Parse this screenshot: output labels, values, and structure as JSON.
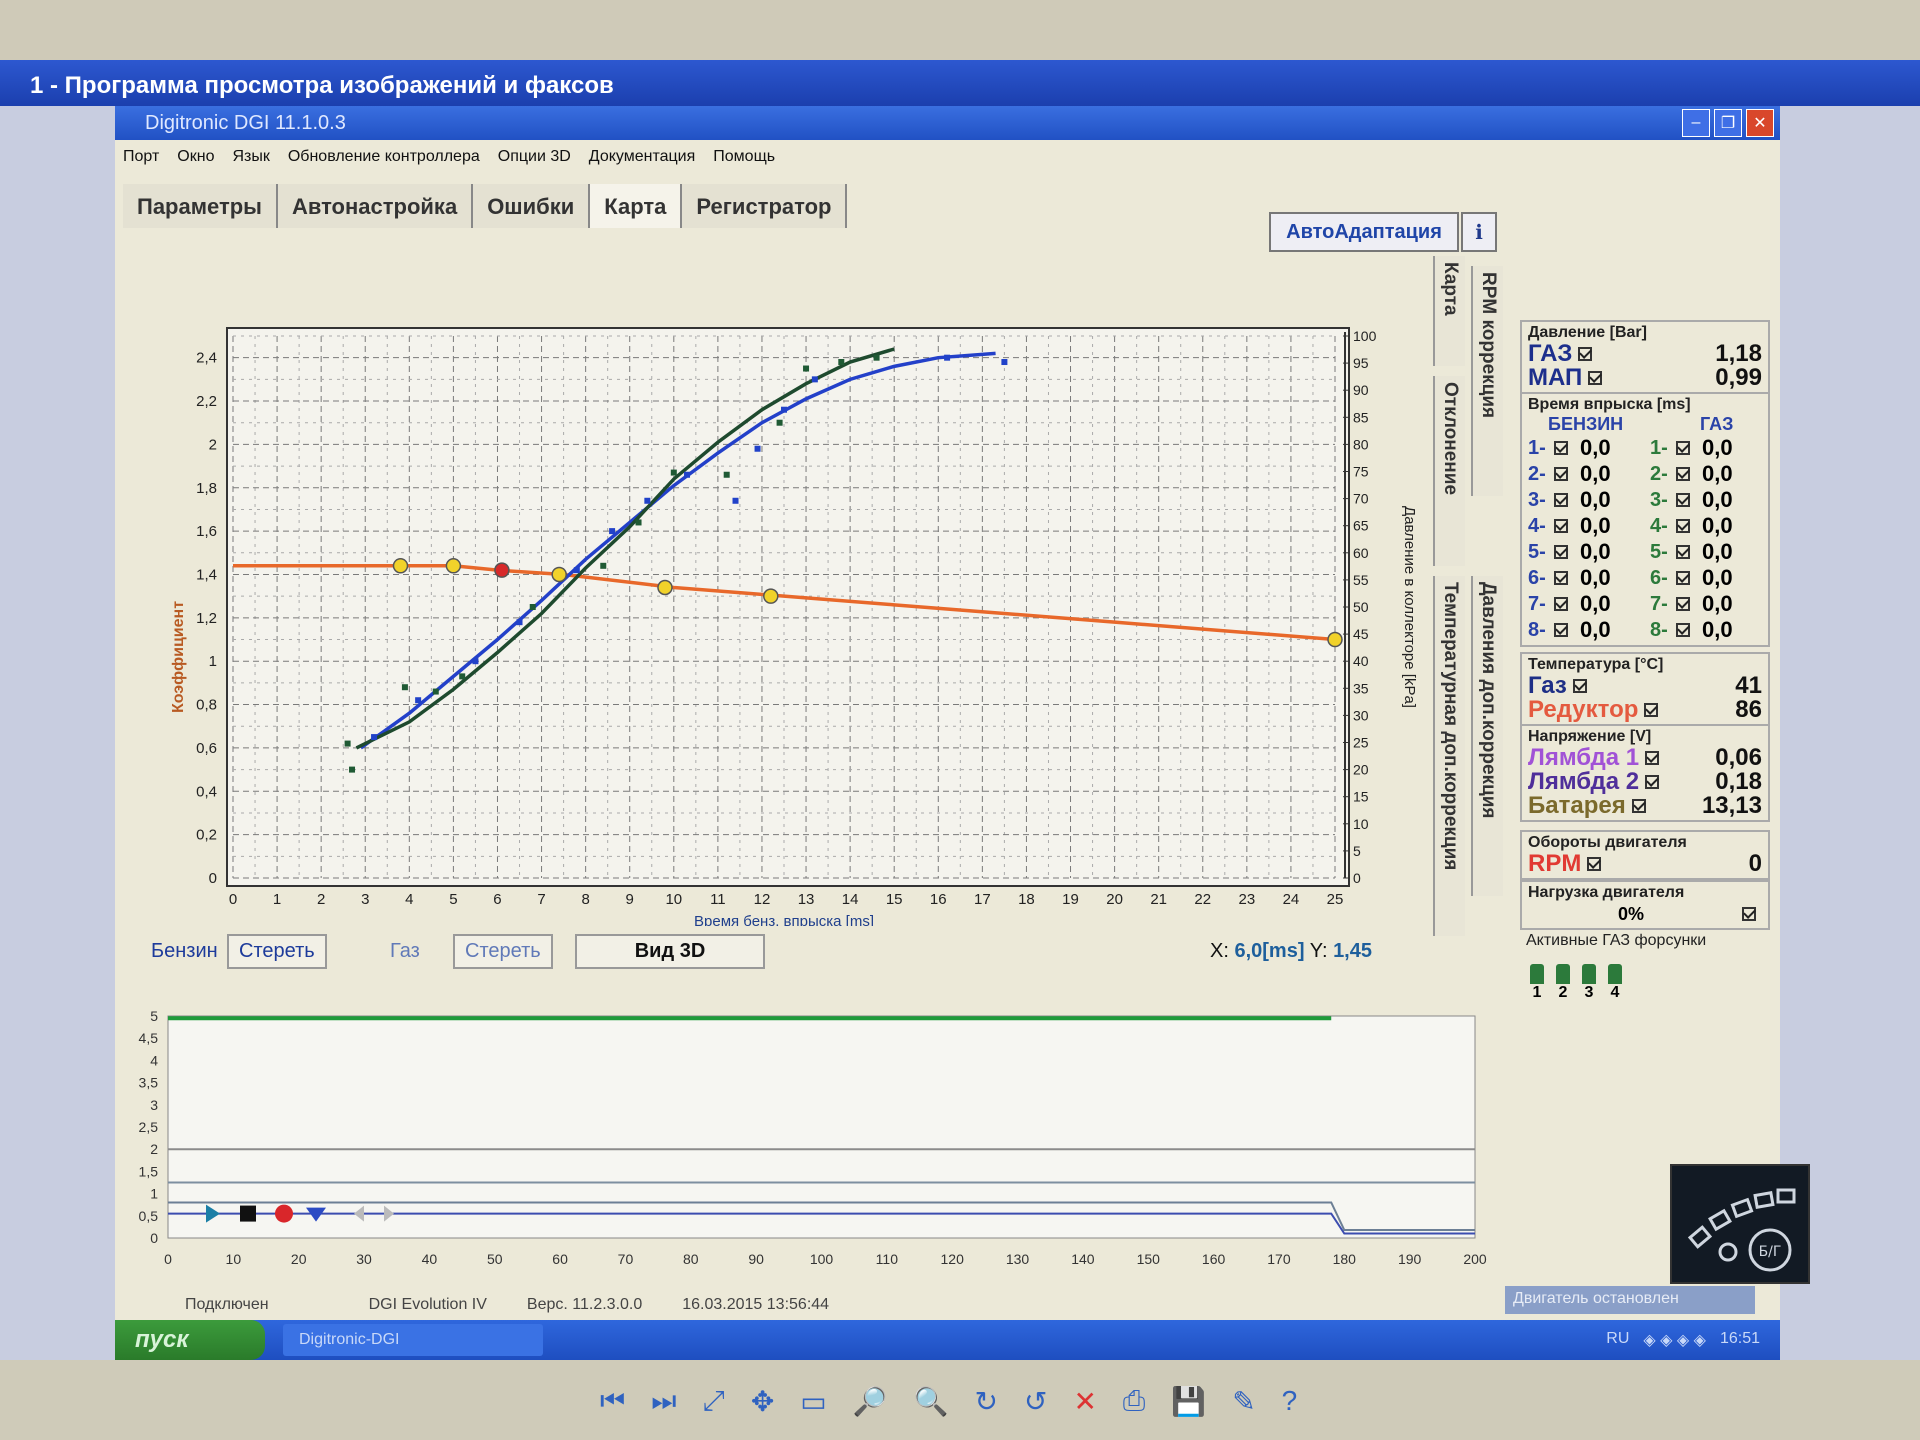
{
  "viewer": {
    "title": "1 - Программа просмотра изображений и факсов",
    "toolbar_icons": [
      "prev-icon",
      "next-icon",
      "fit-icon",
      "actual-size-icon",
      "slideshow-icon",
      "zoom-in-icon",
      "zoom-out-icon",
      "rotate-cw-icon",
      "rotate-ccw-icon",
      "delete-icon",
      "print-icon",
      "save-icon",
      "edit-icon",
      "help-icon"
    ]
  },
  "app": {
    "title": "Digitronic DGI 11.1.0.3",
    "menu": [
      "Порт",
      "Окно",
      "Язык",
      "Обновление контроллера",
      "Опции 3D",
      "Документация",
      "Помощь"
    ],
    "tabs": [
      "Параметры",
      "Автонастройка",
      "Ошибки",
      "Карта",
      "Регистратор"
    ],
    "active_tab": "Карта",
    "autoadapt_label": "АвтоАдаптация",
    "info_label": "ℹ",
    "vtabs": [
      "RPM коррекция",
      "Карта",
      "Отклонение",
      "Давления доп.коррекция",
      "Температурная доп.коррекция"
    ]
  },
  "controls": {
    "petrol_label": "Бензин",
    "erase1": "Стереть",
    "gas_label": "Газ",
    "erase2": "Стереть",
    "view3d": "Вид 3D",
    "coord_x_label": "X:",
    "coord_x": "6,0[ms]",
    "coord_y_label": "Y:",
    "coord_y": "1,45"
  },
  "panel": {
    "pressure_title": "Давление [Bar]",
    "gas_label": "ГАЗ",
    "gas_val": "1,18",
    "map_label": "МАП",
    "map_val": "0,99",
    "inj_title": "Время впрыска [ms]",
    "petrol_col": "БЕНЗИН",
    "gas_col": "ГАЗ",
    "petrol_inj": [
      [
        "1-",
        "0,0"
      ],
      [
        "2-",
        "0,0"
      ],
      [
        "3-",
        "0,0"
      ],
      [
        "4-",
        "0,0"
      ],
      [
        "5-",
        "0,0"
      ],
      [
        "6-",
        "0,0"
      ],
      [
        "7-",
        "0,0"
      ],
      [
        "8-",
        "0,0"
      ]
    ],
    "gas_inj": [
      [
        "1-",
        "0,0"
      ],
      [
        "2-",
        "0,0"
      ],
      [
        "3-",
        "0,0"
      ],
      [
        "4-",
        "0,0"
      ],
      [
        "5-",
        "0,0"
      ],
      [
        "6-",
        "0,0"
      ],
      [
        "7-",
        "0,0"
      ],
      [
        "8-",
        "0,0"
      ]
    ],
    "temp_title": "Температура [°C]",
    "temp_gas_label": "Газ",
    "temp_gas_val": "41",
    "temp_red_label": "Редуктор",
    "temp_red_val": "86",
    "volt_title": "Напряжение [V]",
    "lambda1_label": "Лямбда 1",
    "lambda1_val": "0,06",
    "lambda2_label": "Лямбда 2",
    "lambda2_val": "0,18",
    "battery_label": "Батарея",
    "battery_val": "13,13",
    "rpm_title": "Обороты двигателя",
    "rpm_label": "RPM",
    "rpm_val": "0",
    "load_title": "Нагрузка двигателя",
    "load_val": "0%",
    "active_inj_title": "Активные ГАЗ форсунки",
    "active_inj": [
      "1",
      "2",
      "3",
      "4"
    ],
    "logo_text": "Б/Г"
  },
  "status": {
    "connected": "Подключен",
    "device": "DGI Evolution IV",
    "version": "Верс. 11.2.3.0.0",
    "datetime": "16.03.2015 13:56:44",
    "engine": "Двигатель остановлен"
  },
  "taskbar": {
    "start": "пуск",
    "task": "Digitronic-DGI",
    "lang": "RU",
    "time": "16:51"
  },
  "chart_data": [
    {
      "type": "line",
      "xlabel": "Время бенз. впрыска [ms]",
      "ylabel": "Коэффициент",
      "y2label": "Давление в коллекторе [kPa]",
      "xlim": [
        0,
        25
      ],
      "ylim": [
        0,
        2.5
      ],
      "y2lim": [
        0,
        100
      ],
      "x_ticks": [
        0,
        1,
        2,
        3,
        4,
        5,
        6,
        7,
        8,
        9,
        10,
        11,
        12,
        13,
        14,
        15,
        16,
        17,
        18,
        19,
        20,
        21,
        22,
        23,
        24,
        25
      ],
      "y_ticks": [
        "0",
        "0,2",
        "0,4",
        "0,6",
        "0,8",
        "1",
        "1,2",
        "1,4",
        "1,6",
        "1,8",
        "2",
        "2,2",
        "2,4"
      ],
      "y2_ticks": [
        0,
        5,
        10,
        15,
        20,
        25,
        30,
        35,
        40,
        45,
        50,
        55,
        60,
        65,
        70,
        75,
        80,
        85,
        90,
        95,
        100
      ],
      "grid": true,
      "series": [
        {
          "color": "#e8682a",
          "x": [
            0,
            4,
            5,
            6,
            7.5,
            10,
            12.5,
            15,
            17.5,
            20,
            22.5,
            25
          ],
          "y": [
            1.44,
            1.44,
            1.44,
            1.42,
            1.4,
            1.34,
            1.3,
            1.26,
            1.22,
            1.18,
            1.14,
            1.1
          ]
        },
        {
          "color": "#2340c9",
          "x": [
            2.9,
            4,
            5,
            6,
            7,
            8,
            9,
            10,
            11,
            12,
            13,
            14,
            15,
            16,
            17.3
          ],
          "y": [
            0.6,
            0.76,
            0.93,
            1.1,
            1.28,
            1.47,
            1.64,
            1.81,
            1.96,
            2.1,
            2.21,
            2.3,
            2.36,
            2.4,
            2.42
          ]
        },
        {
          "color": "#1e4a2e",
          "x": [
            2.8,
            4,
            5,
            6,
            7,
            8,
            9,
            10,
            11,
            12,
            13,
            14,
            15
          ],
          "y": [
            0.6,
            0.72,
            0.87,
            1.04,
            1.22,
            1.43,
            1.62,
            1.84,
            2.01,
            2.16,
            2.28,
            2.38,
            2.44
          ]
        }
      ],
      "markers_yellow": [
        [
          3.8,
          1.44
        ],
        [
          5,
          1.44
        ],
        [
          7.4,
          1.4
        ],
        [
          9.8,
          1.34
        ],
        [
          12.2,
          1.3
        ],
        [
          25,
          1.1
        ]
      ],
      "markers_red": [
        [
          6.1,
          1.42
        ]
      ],
      "scatter_blue": [
        [
          3.2,
          0.65
        ],
        [
          4.2,
          0.82
        ],
        [
          5.5,
          1.0
        ],
        [
          6.5,
          1.18
        ],
        [
          7.8,
          1.42
        ],
        [
          8.6,
          1.6
        ],
        [
          9.4,
          1.74
        ],
        [
          10.3,
          1.86
        ],
        [
          11.4,
          1.74
        ],
        [
          11.9,
          1.98
        ],
        [
          12.5,
          2.16
        ],
        [
          13.2,
          2.3
        ],
        [
          16.2,
          2.4
        ],
        [
          17.5,
          2.38
        ]
      ],
      "scatter_green": [
        [
          2.6,
          0.62
        ],
        [
          2.7,
          0.5
        ],
        [
          3.9,
          0.88
        ],
        [
          4.6,
          0.86
        ],
        [
          5.2,
          0.93
        ],
        [
          6.8,
          1.25
        ],
        [
          8.4,
          1.44
        ],
        [
          9.2,
          1.64
        ],
        [
          10,
          1.87
        ],
        [
          11.2,
          1.86
        ],
        [
          12.4,
          2.1
        ],
        [
          13,
          2.35
        ],
        [
          13.8,
          2.38
        ],
        [
          14.6,
          2.4
        ]
      ]
    },
    {
      "type": "line",
      "xlim": [
        0,
        200
      ],
      "ylim": [
        0,
        5
      ],
      "x_ticks": [
        0,
        10,
        20,
        30,
        40,
        50,
        60,
        70,
        80,
        90,
        100,
        110,
        120,
        130,
        140,
        150,
        160,
        170,
        180,
        190,
        200
      ],
      "y_ticks": [
        "0",
        "0,5",
        "1",
        "1,5",
        "2",
        "2,5",
        "3",
        "3,5",
        "4",
        "4,5",
        "5"
      ],
      "series": [
        {
          "color": "#1f9b3a",
          "x": [
            0,
            178
          ],
          "y": [
            4.95,
            4.95
          ]
        },
        {
          "color": "#8b8b8b",
          "x": [
            0,
            200
          ],
          "y": [
            2.0,
            2.0
          ]
        },
        {
          "color": "#7d8fa0",
          "x": [
            0,
            200
          ],
          "y": [
            1.25,
            1.25
          ]
        },
        {
          "color": "#6c7f95",
          "x": [
            0,
            178,
            180,
            200
          ],
          "y": [
            0.8,
            0.8,
            0.18,
            0.18
          ]
        },
        {
          "color": "#3c4db0",
          "x": [
            0,
            178,
            180,
            200
          ],
          "y": [
            0.55,
            0.55,
            0.1,
            0.1
          ]
        }
      ]
    }
  ]
}
